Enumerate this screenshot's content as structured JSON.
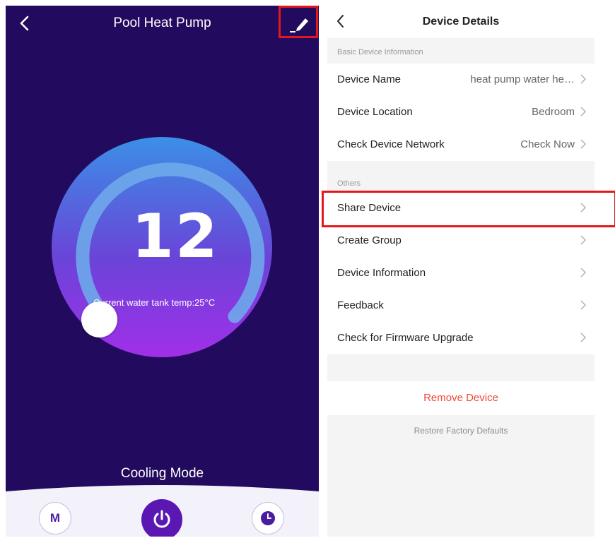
{
  "left": {
    "title": "Pool Heat Pump",
    "temperature": "12",
    "unit": "°C",
    "current_temp_text": "Current water tank temp:25°C",
    "mode_label": "Cooling Mode",
    "mode_button_label": "M",
    "colors": {
      "background": "#220b5e",
      "power_button": "#5b17b2",
      "highlight_border": "#e2181b"
    },
    "icons": [
      "back-arrow-icon",
      "edit-pencil-icon",
      "power-icon",
      "clock-icon"
    ]
  },
  "right": {
    "title": "Device Details",
    "basic_section_label": "Basic Device Information",
    "basic_rows": [
      {
        "label": "Device Name",
        "value": "heat pump water he…"
      },
      {
        "label": "Device Location",
        "value": "Bedroom"
      },
      {
        "label": "Check Device Network",
        "value": "Check Now"
      }
    ],
    "others_section_label": "Others",
    "other_rows": [
      {
        "label": "Share Device"
      },
      {
        "label": "Create Group"
      },
      {
        "label": "Device Information"
      },
      {
        "label": "Feedback"
      },
      {
        "label": "Check for Firmware Upgrade"
      }
    ],
    "remove_label": "Remove Device",
    "restore_label": "Restore Factory Defaults",
    "colors": {
      "remove_text": "#f04a3c",
      "background": "#f4f4f5"
    }
  }
}
